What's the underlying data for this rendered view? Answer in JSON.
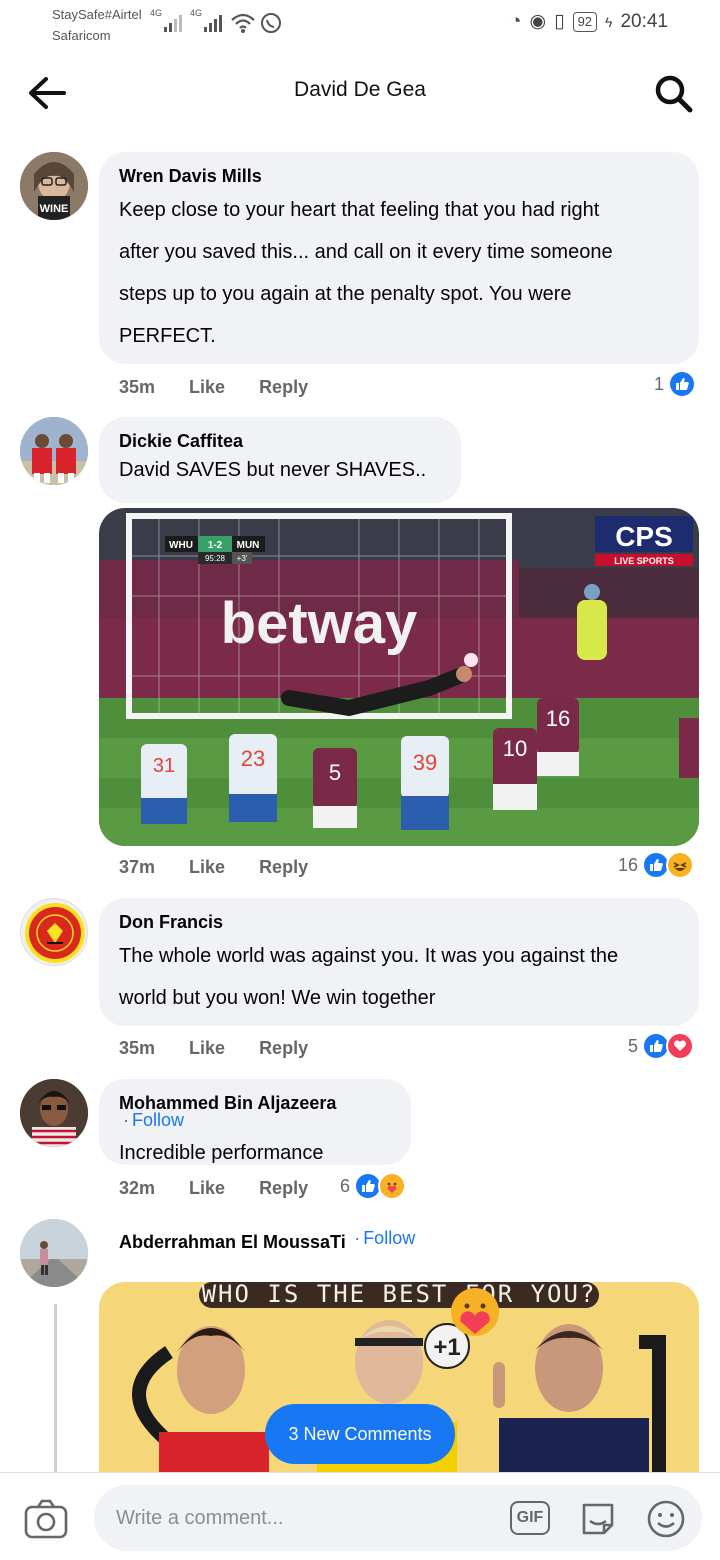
{
  "status_bar": {
    "carrier_line1": "StaySafe#Airtel",
    "carrier_line2": "Safaricom",
    "network1": "4G",
    "network2": "4G",
    "battery": "92",
    "time": "20:41"
  },
  "header": {
    "title": "David De Gea"
  },
  "comments": [
    {
      "author": "Wren Davis Mills",
      "text_lines": [
        "Keep close to your heart that feeling that you had right",
        "after you saved this... and call on it every time someone",
        "steps up to you again at the penalty spot.  You were",
        "PERFECT."
      ],
      "time": "35m",
      "like": "Like",
      "reply": "Reply",
      "reaction_count": "1"
    },
    {
      "author": "Dickie Caffitea",
      "text": "David SAVES but never SHAVES..",
      "time": "37m",
      "like": "Like",
      "reply": "Reply",
      "reaction_count": "16",
      "image": {
        "score_home": "WHU",
        "score": "1-2",
        "score_away": "MUN",
        "clock": "95:28",
        "added": "+3'",
        "broadcaster": "CPS",
        "broadcaster_sub": "LIVE SPORTS",
        "board_text": "betway",
        "shirt_numbers": [
          "31",
          "23",
          "5",
          "39",
          "10",
          "16"
        ]
      }
    },
    {
      "author": "Don Francis",
      "text_lines": [
        "The whole world was against you. It was you against the",
        "world but you won! We win together"
      ],
      "time": "35m",
      "like": "Like",
      "reply": "Reply",
      "reaction_count": "5"
    },
    {
      "author": "Mohammed Bin Aljazeera",
      "follow": "Follow",
      "text": "Incredible performance",
      "time": "32m",
      "like": "Like",
      "reply": "Reply",
      "reaction_count": "6"
    },
    {
      "author": "Abderrahman El MoussaTi",
      "follow": "Follow",
      "image": {
        "headline": "WHO IS THE BEST FOR YOU?",
        "badge": "+1"
      }
    }
  ],
  "new_comments_label": "3 New Comments",
  "composer": {
    "placeholder": "Write a comment...",
    "gif_label": "GIF"
  },
  "colors": {
    "accent": "#1877f2",
    "bubble": "#f0f2f5",
    "meta_text": "#65676b"
  }
}
